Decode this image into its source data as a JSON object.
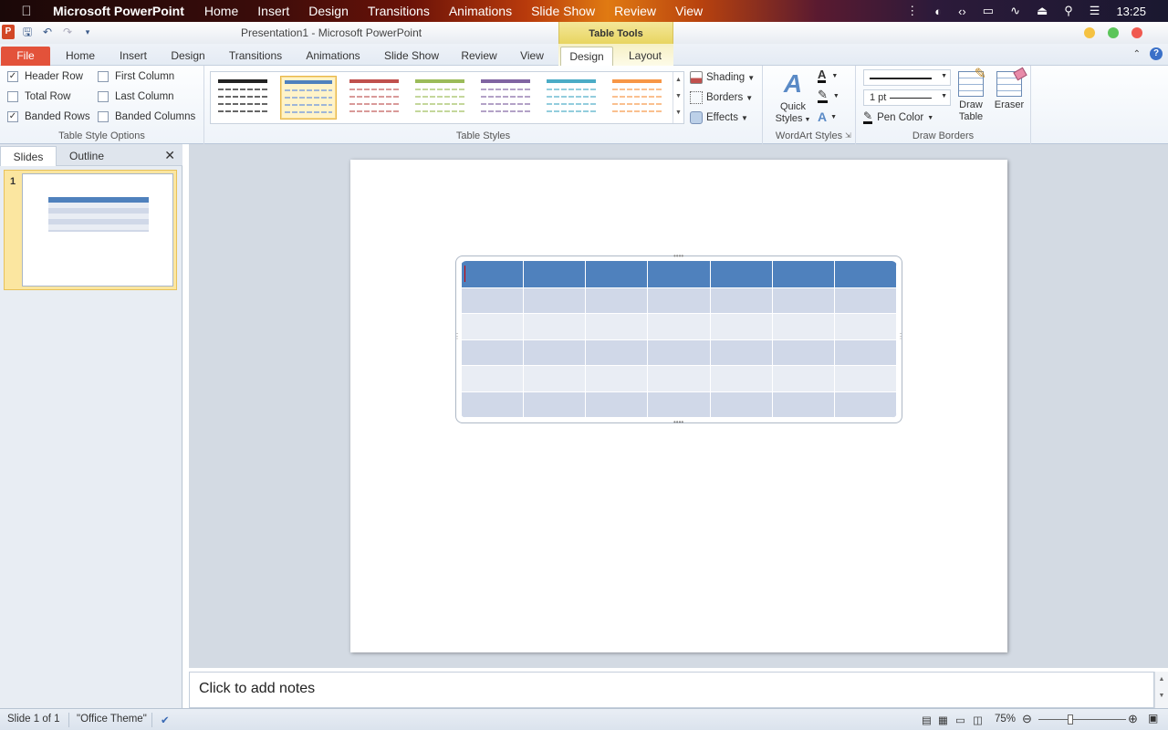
{
  "menubar": {
    "app_name": "Microsoft PowerPoint",
    "items": [
      "Home",
      "Insert",
      "Design",
      "Transitions",
      "Animations",
      "Slide Show",
      "Review",
      "View"
    ],
    "clock": "13:25"
  },
  "titlebar": {
    "window_title": "Presentation1 - Microsoft PowerPoint",
    "context_group": "Table Tools",
    "app_icon_letter": "P"
  },
  "ribbon_tabs": {
    "file": "File",
    "home": "Home",
    "insert": "Insert",
    "design": "Design",
    "transitions": "Transitions",
    "animations": "Animations",
    "slide_show": "Slide Show",
    "review": "Review",
    "view": "View",
    "ctx_design": "Design",
    "ctx_layout": "Layout"
  },
  "table_style_options": {
    "label": "Table Style Options",
    "header_row": {
      "label": "Header Row",
      "checked": true
    },
    "total_row": {
      "label": "Total Row",
      "checked": false
    },
    "banded_rows": {
      "label": "Banded Rows",
      "checked": true
    },
    "first_column": {
      "label": "First Column",
      "checked": false
    },
    "last_column": {
      "label": "Last Column",
      "checked": false
    },
    "banded_columns": {
      "label": "Banded Columns",
      "checked": false
    }
  },
  "table_styles": {
    "label": "Table Styles",
    "swatches": [
      {
        "name": "black",
        "color": "#222222",
        "light": "#666666"
      },
      {
        "name": "blue",
        "color": "#4f81bd",
        "light": "#9fb6d8",
        "selected": true
      },
      {
        "name": "red",
        "color": "#c0504d",
        "light": "#d99a99"
      },
      {
        "name": "green",
        "color": "#9bbb59",
        "light": "#c4d79b"
      },
      {
        "name": "purple",
        "color": "#8064a2",
        "light": "#b3a2c7"
      },
      {
        "name": "aqua",
        "color": "#4bacc6",
        "light": "#93cddd"
      },
      {
        "name": "orange",
        "color": "#f79646",
        "light": "#fac08f"
      }
    ],
    "shading": "Shading",
    "borders": "Borders",
    "effects": "Effects"
  },
  "wordart": {
    "label": "WordArt Styles",
    "quick_styles_line1": "Quick",
    "quick_styles_line2": "Styles"
  },
  "draw_borders": {
    "label": "Draw Borders",
    "pen_weight": "1 pt",
    "pen_color": "Pen Color",
    "draw_table_line1": "Draw",
    "draw_table_line2": "Table",
    "eraser": "Eraser"
  },
  "slides_panel": {
    "tab_slides": "Slides",
    "tab_outline": "Outline",
    "slide_number": "1"
  },
  "table": {
    "columns": 7,
    "header_color": "#4f81bd",
    "band_dark": "#d0d8e8",
    "band_light": "#e9edf4"
  },
  "notes": {
    "placeholder": "Click to add notes"
  },
  "statusbar": {
    "slide_info": "Slide 1 of 1",
    "theme": "\"Office Theme\"",
    "zoom": "75%"
  }
}
